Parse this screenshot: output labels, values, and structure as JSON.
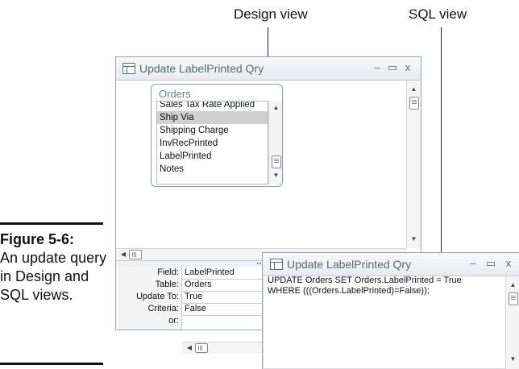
{
  "callouts": {
    "design_view": "Design view",
    "sql_view": "SQL view"
  },
  "figure": {
    "number": "Figure 5-6:",
    "caption": "An update query in Design and SQL views."
  },
  "design_window": {
    "title": "Update LabelPrinted Qry",
    "buttons": {
      "minimize": "–",
      "maximize": "▭",
      "close": "x"
    },
    "table_box": {
      "title": "Orders",
      "fields": [
        "Sales Tax Rate Applied",
        "Ship Via",
        "Shipping Charge",
        "InvRecPrinted",
        "LabelPrinted",
        "Notes"
      ],
      "selected": "Ship Via"
    },
    "grid": {
      "rows": [
        {
          "label": "Field:",
          "value": "LabelPrinted"
        },
        {
          "label": "Table:",
          "value": "Orders"
        },
        {
          "label": "Update To:",
          "value": "True"
        },
        {
          "label": "Criteria:",
          "value": "False"
        },
        {
          "label": "or:",
          "value": ""
        }
      ]
    }
  },
  "sql_window": {
    "title": "Update LabelPrinted Qry",
    "buttons": {
      "minimize": "–",
      "maximize": "▭",
      "close": "x"
    },
    "sql_text": "UPDATE Orders SET Orders.LabelPrinted = True\nWHERE (((Orders.LabelPrinted)=False));"
  },
  "icons": {
    "query": "query-icon",
    "scroll_up": "scroll-up-arrow-icon",
    "scroll_down": "scroll-down-arrow-icon",
    "scroll_left": "scroll-left-arrow-icon",
    "scroll_right": "scroll-right-arrow-icon"
  }
}
